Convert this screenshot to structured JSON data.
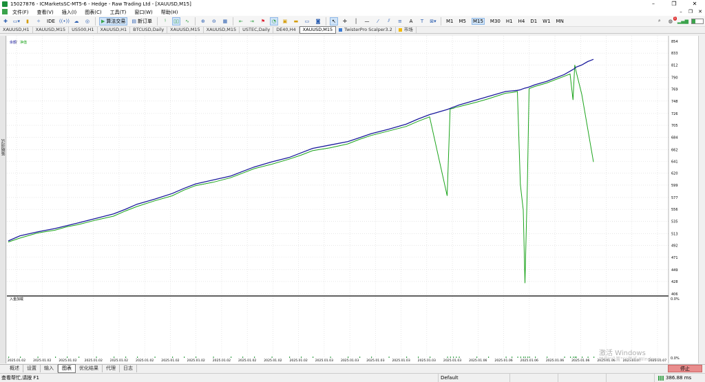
{
  "window": {
    "title": "15027876 - ICMarketsSC-MT5-6 - Hedge - Raw Trading Ltd - [XAUUSD,M15]"
  },
  "window_controls": [
    "–",
    "❐",
    "✕"
  ],
  "mdi_controls": [
    "–",
    "❐",
    "✕"
  ],
  "menu": [
    "文件(F)",
    "查看(V)",
    "插入(I)",
    "图表(C)",
    "工具(T)",
    "窗口(W)",
    "帮助(H)"
  ],
  "toolbar": {
    "ide_label": "IDE",
    "algo_label": "算法交易",
    "new_order_label": "新订单",
    "timeframes": [
      "M1",
      "M5",
      "M15",
      "M30",
      "H1",
      "H4",
      "D1",
      "W1",
      "MN"
    ],
    "active_timeframe": "M15",
    "notification_count": "1"
  },
  "tabs": [
    "XAUUSD,H1",
    "XAUUSD,M15",
    "US500,H1",
    "XAUUSD,H1",
    "BTCUSD,Daily",
    "XAUUSD,M15",
    "XAUUSD,M15",
    "USTEC,Daily",
    "DE40,H4",
    "XAUUSD,M15",
    "TwisterPro Scalper3.2",
    "市场"
  ],
  "active_tab": 9,
  "left_panel_label": "策略测试",
  "chart": {
    "legend_balance": "余额",
    "legend_sep": " / ",
    "legend_equity": "净值",
    "lower_label": "入金加载",
    "lower_scale_top": "0.0%",
    "lower_scale_bottom": "0.0%"
  },
  "bottom_tabs": [
    "概述",
    "设置",
    "输入",
    "图表",
    "优化结果",
    "代理",
    "日志"
  ],
  "active_bottom_tab": 3,
  "stop_button": "停止",
  "status": {
    "left": "查看帮忙,请按 F1",
    "profile": "Default",
    "ping": "386.88 ms"
  },
  "watermark": {
    "line1": "激活 Windows",
    "line2": "转到\"设置\"以激活 Windows。"
  },
  "colors": {
    "balance": "#1a1a9c",
    "equity": "#1aa31a",
    "stop": "#e98d8d"
  },
  "chart_data": {
    "type": "line",
    "y_ticks": [
      "406",
      "428",
      "449",
      "471",
      "492",
      "513",
      "535",
      "556",
      "577",
      "599",
      "620",
      "641",
      "662",
      "684",
      "705",
      "726",
      "748",
      "769",
      "790",
      "812",
      "833",
      "854"
    ],
    "ylim": [
      406,
      854
    ],
    "x_tick_labels": [
      "2025.01.02",
      "2025.01.02",
      "2025.01.02",
      "2025.01.02",
      "2025.01.02",
      "2025.01.02",
      "2025.01.02",
      "2025.01.02",
      "2025.01.02",
      "2025.01.02",
      "2025.01.02",
      "2025.01.02",
      "2025.01.03",
      "2025.01.03",
      "2025.01.03",
      "2025.01.03",
      "2025.01.03",
      "2025.01.03",
      "2025.01.06",
      "2025.01.06",
      "2025.01.06",
      "2025.01.06",
      "2025.01.06",
      "2025.01.06",
      "2025.01.07",
      "2025.01.07"
    ],
    "x": [
      0,
      2,
      5,
      8,
      10,
      12,
      15,
      18,
      20,
      22,
      25,
      28,
      30,
      32,
      35,
      38,
      40,
      42,
      45,
      48,
      50,
      52,
      55,
      58,
      60,
      62,
      65,
      68,
      70,
      72,
      75,
      75.5,
      76,
      76.5,
      77,
      80,
      82,
      85,
      86,
      87,
      87.5,
      88,
      88.3,
      88.7,
      89,
      90,
      92,
      95,
      96,
      96.5,
      96.8,
      97,
      98,
      99,
      100
    ],
    "series": [
      {
        "name": "余额",
        "values": [
          500,
          509,
          516,
          522,
          527,
          532,
          540,
          548,
          556,
          565,
          574,
          584,
          593,
          601,
          608,
          615,
          623,
          631,
          640,
          648,
          656,
          664,
          670,
          676,
          683,
          690,
          698,
          707,
          716,
          724,
          733,
          735,
          737,
          739,
          741,
          750,
          756,
          765,
          766,
          767,
          768,
          770,
          771,
          772,
          773,
          777,
          783,
          795,
          801,
          804,
          806,
          808,
          812,
          818,
          822
        ]
      },
      {
        "name": "净值",
        "values": [
          498,
          505,
          514,
          519,
          525,
          529,
          537,
          544,
          553,
          561,
          571,
          580,
          590,
          598,
          604,
          612,
          620,
          628,
          636,
          645,
          652,
          660,
          665,
          672,
          680,
          687,
          695,
          703,
          712,
          720,
          580,
          734,
          735,
          737,
          738,
          746,
          752,
          762,
          763,
          765,
          600,
          555,
          425,
          600,
          770,
          774,
          780,
          792,
          796,
          750,
          812,
          802,
          760,
          700,
          640
        ]
      }
    ]
  }
}
